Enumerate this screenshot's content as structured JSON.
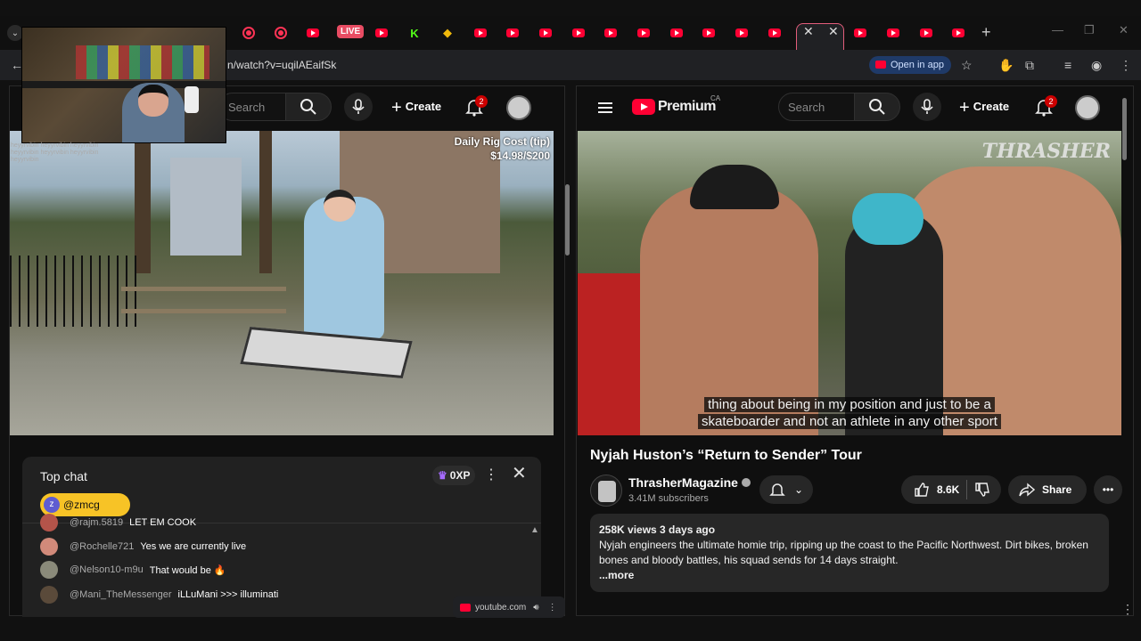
{
  "browser": {
    "url": "n/watch?v=uqilAEaifSk",
    "open_in_app": "Open in app",
    "live_badge": "LIVE",
    "new_tab": "+"
  },
  "left": {
    "search_placeholder": "Search",
    "create_label": "Create",
    "notif_count": "2",
    "overlay_tip_title": "Daily Rig Cost (tip)",
    "overlay_tip_amount": "$14.98/$200",
    "webcam_chat_text": "heyyrvibin heyyrvibin heyyrvibin heyyrvibin heyyrvibin heyyrvibin heyyrvibin",
    "chat": {
      "title": "Top chat",
      "xp": "0XP",
      "mention_initial": "z",
      "mention_label": "@zmcg",
      "messages": [
        {
          "user": "@rajm.5819",
          "text": "LET EM COOK",
          "color": "#b4544a"
        },
        {
          "user": "@Rochelle721",
          "text": "Yes we are currently live",
          "color": "#d18a7a"
        },
        {
          "user": "@Nelson10-m9u",
          "text": "That would be 🔥",
          "color": "#8a8a7a"
        },
        {
          "user": "@Mani_TheMessenger",
          "text": "iLLuMani >>> illuminati",
          "color": "#5a4a3a"
        }
      ]
    },
    "footer_source": "youtube.com"
  },
  "right": {
    "logo_text": "Premium",
    "region": "CA",
    "search_placeholder": "Search",
    "create_label": "Create",
    "notif_count": "2",
    "watermark": "THRASHER",
    "caption_line1": "thing about being in my position and just to be a",
    "caption_line2": "skateboarder and not an athlete in any other sport",
    "video_title": "Nyjah Huston’s “Return to Sender” Tour",
    "channel_name": "ThrasherMagazine",
    "subscribers": "3.41M subscribers",
    "likes": "8.6K",
    "share_label": "Share",
    "views_meta": "258K views  3 days ago",
    "description": "Nyjah engineers the ultimate homie trip, ripping up the coast to the Pacific Northwest. Dirt bikes, broken bones and bloody battles, his squad sends for 14 days straight.",
    "more_label": "...more"
  },
  "colors": {
    "youtube_red": "#ff0033",
    "mention_yellow": "#f7c326",
    "open_in_app_bg": "#1f3a68"
  }
}
